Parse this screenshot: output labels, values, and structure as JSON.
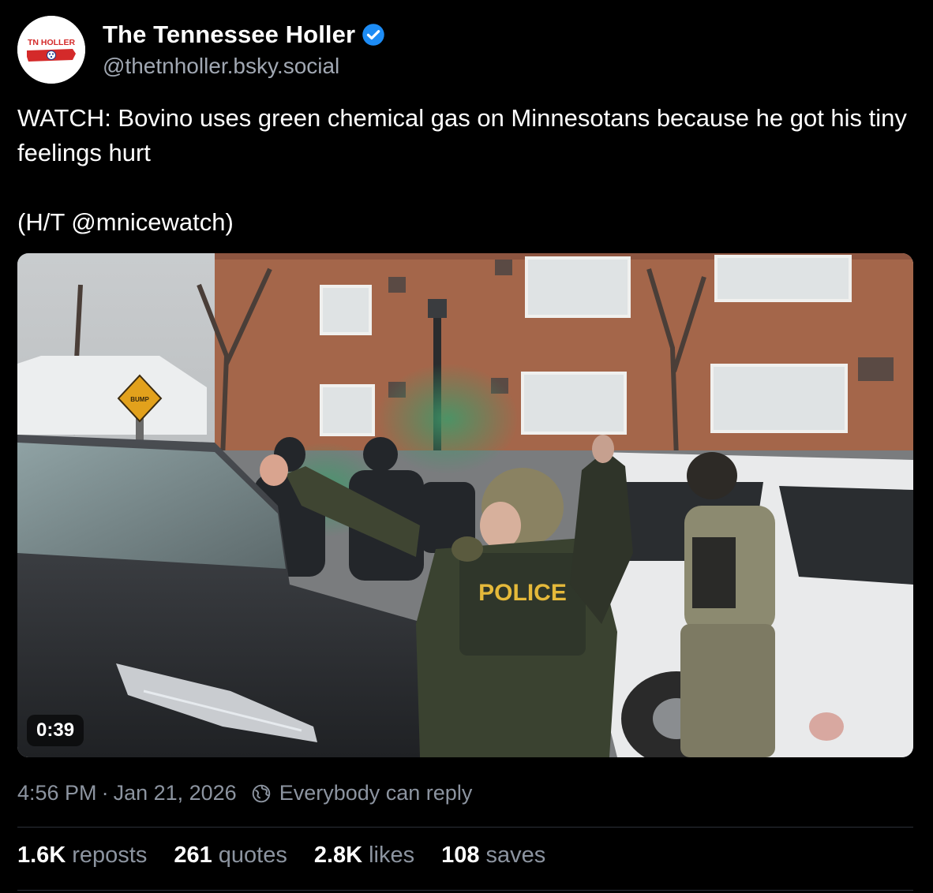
{
  "author": {
    "display_name": "The Tennessee Holler",
    "handle": "@thetnholler.bsky.social",
    "avatar_text": "TN HOLLER",
    "verified": true
  },
  "post": {
    "text_line1": "WATCH: Bovino uses green chemical gas on Minnesotans because he got his tiny feelings hurt",
    "text_line2": "(H/T @mnicewatch)"
  },
  "media": {
    "type": "video",
    "duration": "0:39",
    "scene_text": {
      "sign": "BUMP",
      "vest": "POLICE"
    }
  },
  "meta": {
    "time": "4:56 PM",
    "separator": "·",
    "date": "Jan 21, 2026",
    "reply_setting": "Everybody can reply"
  },
  "stats": [
    {
      "value": "1.6K",
      "label": "reposts"
    },
    {
      "value": "261",
      "label": "quotes"
    },
    {
      "value": "2.8K",
      "label": "likes"
    },
    {
      "value": "108",
      "label": "saves"
    }
  ],
  "colors": {
    "background": "#000000",
    "text": "#ffffff",
    "muted": "#8c94a0",
    "verified": "#1d8cf5",
    "divider": "#2c3038",
    "brand_red": "#d42a2a"
  }
}
